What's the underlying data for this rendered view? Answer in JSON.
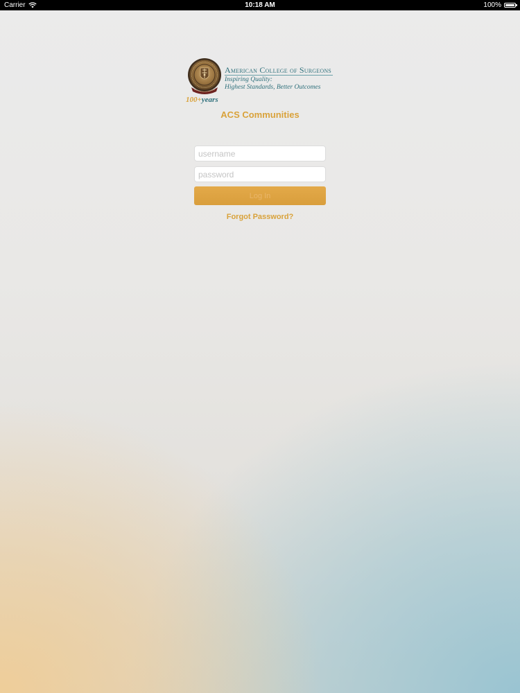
{
  "status_bar": {
    "carrier": "Carrier",
    "time": "10:18 AM",
    "battery": "100%",
    "icons": [
      "wifi-icon",
      "battery-icon"
    ]
  },
  "logo": {
    "org_name": "American College of Surgeons",
    "tagline_line1": "Inspiring Quality:",
    "tagline_line2": "Highest Standards, Better Outcomes",
    "years_number": "100+",
    "years_word": "years",
    "icons": [
      "acs-seal-icon"
    ]
  },
  "app_title": "ACS Communities",
  "login_form": {
    "username_placeholder": "username",
    "username_value": "",
    "password_placeholder": "password",
    "password_value": "",
    "login_label": "Log In",
    "forgot_label": "Forgot Password?"
  },
  "colors": {
    "accent": "#d9a23a",
    "brand_teal": "#2d6f7b"
  }
}
